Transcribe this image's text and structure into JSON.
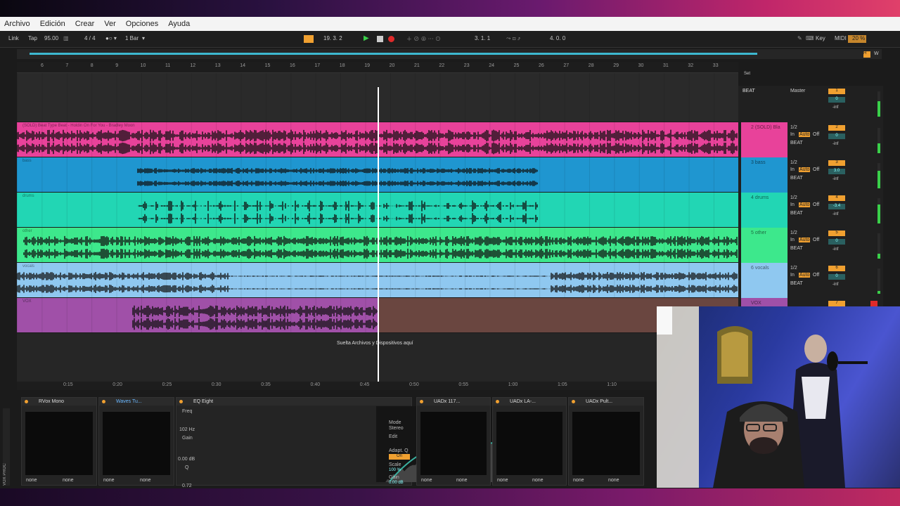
{
  "menu": [
    "Archivo",
    "Edición",
    "Crear",
    "Ver",
    "Opciones",
    "Ayuda"
  ],
  "control": {
    "link": "Link",
    "tap": "Tap",
    "tempo": "95.00",
    "signature": "4 / 4",
    "quantize": "1 Bar",
    "position": "19.  3.  2",
    "loop_start": "3.  1.  1",
    "loop_length": "4.  0.  0",
    "key": "Key",
    "midi": "MIDI",
    "cpu": "20 %",
    "w": "W",
    "set": "Set"
  },
  "bar_numbers": [
    "6",
    "7",
    "8",
    "9",
    "10",
    "11",
    "12",
    "13",
    "14",
    "15",
    "16",
    "17",
    "18",
    "19",
    "20",
    "21",
    "22",
    "23",
    "24",
    "25",
    "26",
    "27",
    "28",
    "29",
    "30",
    "31",
    "32",
    "33"
  ],
  "time_ticks": [
    "0:15",
    "0:20",
    "0:25",
    "0:30",
    "0:35",
    "0:40",
    "0:45",
    "0:50",
    "0:55",
    "1:00",
    "1:05",
    "1:10"
  ],
  "tracks": [
    {
      "clip": "(SOLD) Beat Type Beat - Holdin On For You - Bradley Moon",
      "name": "2 (SOLD) Bla",
      "color": "#e8429a",
      "io": "1/2",
      "group": "BEAT",
      "num": "2",
      "vol": "0",
      "inf": "-inf"
    },
    {
      "clip": "bass",
      "name": "3 bass",
      "color": "#1f96d0",
      "io": "1/2",
      "group": "BEAT",
      "num": "3",
      "vol": "3.0",
      "inf": "-inf"
    },
    {
      "clip": "drums",
      "name": "4 drums",
      "color": "#22d6b4",
      "io": "1/2",
      "group": "BEAT",
      "num": "4",
      "vol": "-3.4",
      "inf": "-inf"
    },
    {
      "clip": "other",
      "name": "5 other",
      "color": "#3de88c",
      "io": "1/2",
      "group": "BEAT",
      "num": "5",
      "vol": "0",
      "inf": "-inf"
    },
    {
      "clip": "vocals",
      "name": "6 vocals",
      "color": "#8fc8f0",
      "io": "1/2",
      "group": "BEAT",
      "num": "6",
      "vol": "0",
      "inf": "-inf"
    },
    {
      "clip": "VOX",
      "name": "VOX",
      "color": "#a050a8",
      "io": "",
      "group": "",
      "num": "7",
      "vol": "",
      "inf": ""
    }
  ],
  "group_track": {
    "name": "BEAT",
    "route": "Master",
    "num": "1",
    "vol": "0",
    "inf": "-inf"
  },
  "monitor": {
    "in": "In",
    "auto": "Auto",
    "off": "Off"
  },
  "drop_hint": "Suelta Archivos y Dispositivos aquí",
  "devices": {
    "rvox": "RVox Mono",
    "tune": "Waves Tu...",
    "eq": "EQ Eight",
    "uad1": "UADx 117...",
    "uad2": "UADx LA-...",
    "uad3": "UADx Pult...",
    "freq_label": "Freq",
    "freq_value": "102 Hz",
    "gain_label": "Gain",
    "gain_value": "0.00 dB",
    "q_label": "Q",
    "q_value": "0.72",
    "mode_label": "Mode",
    "mode_value": "Stereo",
    "edit_label": "Edit",
    "adapt_label": "Adapt. Q",
    "adapt_value": "On",
    "scale_label": "Scale",
    "scale_value": "100 %",
    "out_gain_label": "Gain",
    "out_gain_value": "0.00 dB",
    "none": "none",
    "rack_label": "VOX PROC"
  },
  "colors": {
    "accent": "#f0a030",
    "playhead": "#ffffff",
    "overview": "#3db8d0"
  }
}
